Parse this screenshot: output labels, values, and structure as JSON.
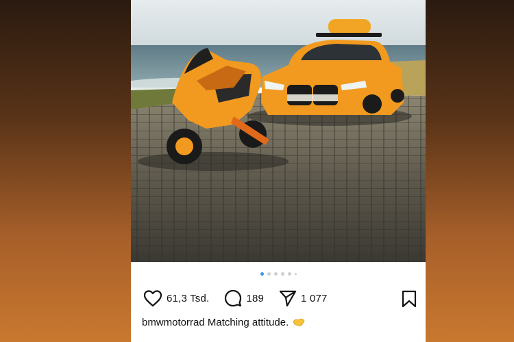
{
  "post": {
    "image_alt_icon": "photo",
    "carousel": {
      "count": 6,
      "active_index": 0
    },
    "actions": {
      "likes": "61,3 Tsd.",
      "comments": "189",
      "shares": "1 077"
    },
    "caption": {
      "username": "bmwmotorrad",
      "text": "Matching attitude."
    }
  },
  "colors": {
    "accent_dot": "#3897f0",
    "text": "#111111",
    "vehicle_orange": "#f29a1f"
  }
}
